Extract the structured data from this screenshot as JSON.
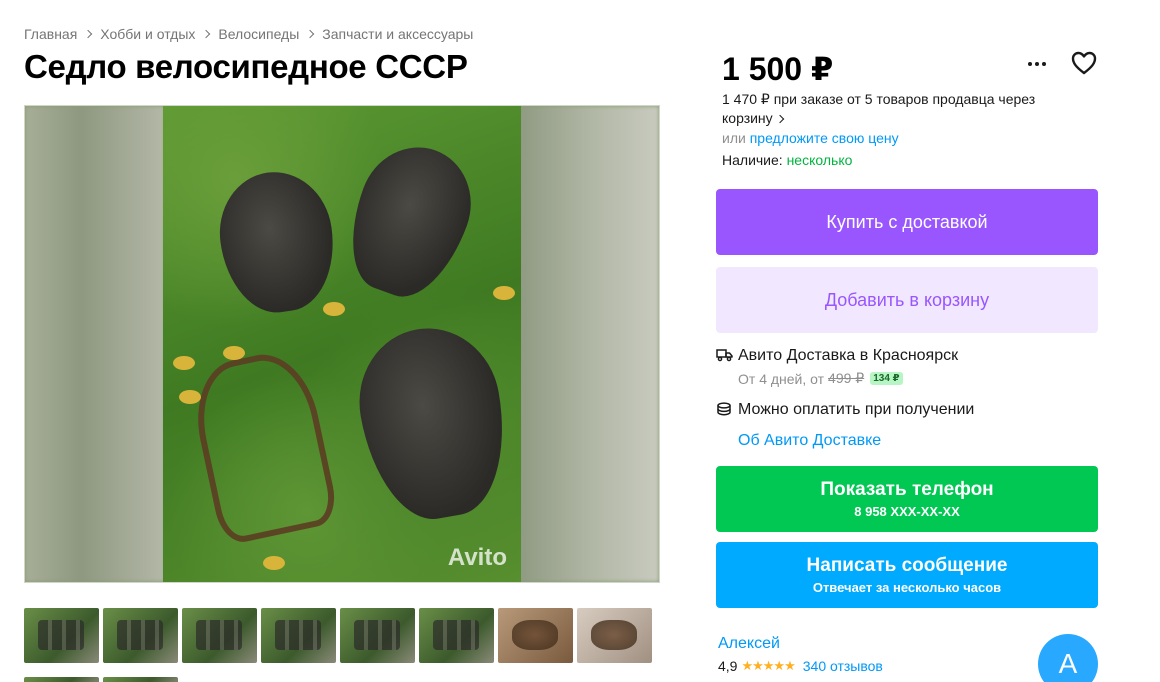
{
  "breadcrumb": [
    "Главная",
    "Хобби и отдых",
    "Велосипеды",
    "Запчасти и аксессуары"
  ],
  "title": "Седло велосипедное СССР",
  "gallery": {
    "watermark": "Avito",
    "thumbnail_count": 8
  },
  "price": {
    "value": "1 500 ₽",
    "bulk_text": "1 470 ₽ при заказе от 5 товаров продавца через корзину",
    "offer_prefix": "или",
    "offer_link": "предложите свою цену",
    "availability_label": "Наличие:",
    "availability_value": "несколько"
  },
  "buttons": {
    "buy": "Купить с доставкой",
    "cart": "Добавить в корзину",
    "phone": "Показать телефон",
    "phone_number": "8 958 XXX-XX-XX",
    "message": "Написать сообщение",
    "message_sub": "Отвечает за несколько часов"
  },
  "delivery": {
    "title": "Авито Доставка в Красноярск",
    "sub_prefix": "От 4 дней, от",
    "old_price": "499 ₽",
    "new_price": "134 ₽",
    "pay_on_receipt": "Можно оплатить при получении",
    "about_link": "Об Авито Доставке"
  },
  "seller": {
    "name": "Алексей",
    "rating": "4,9",
    "stars": "★★★★★",
    "reviews": "340 отзывов",
    "avatar_letter": "А"
  },
  "colors": {
    "buy": "#9956ff",
    "cart_bg": "#f1e8ff",
    "phone": "#00c853",
    "message": "#00aaff",
    "link": "#0099f7",
    "available": "#02b340"
  },
  "icons": [
    "more-icon",
    "heart-icon",
    "truck-icon",
    "coins-icon",
    "chevron-right-icon"
  ]
}
